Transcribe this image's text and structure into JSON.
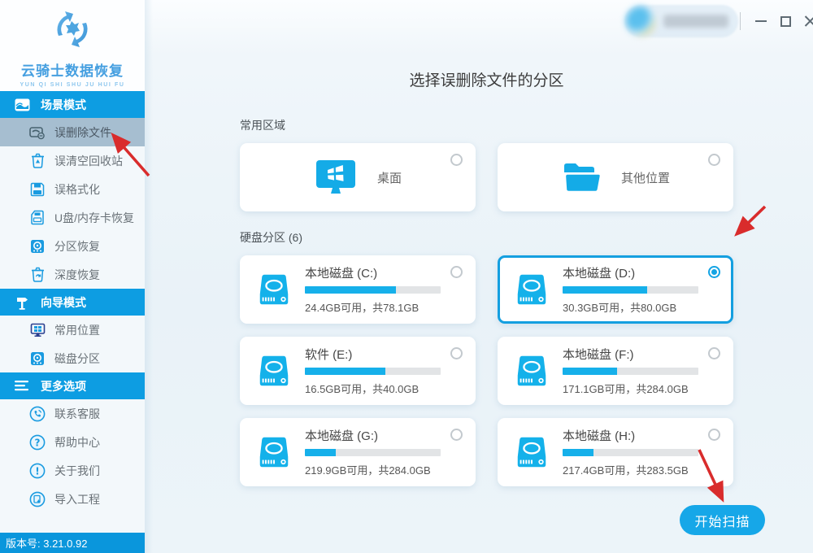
{
  "brand": {
    "name": "云骑士数据恢复",
    "tagline": "YUN QI SHI SHU JU HUI FU",
    "version": "版本号: 3.21.0.92"
  },
  "sidebar": {
    "sections": [
      {
        "label": "场景模式",
        "icon": "scene-mode-icon",
        "items": [
          {
            "label": "误删除文件",
            "icon": "folder-delete-icon",
            "selected": true
          },
          {
            "label": "误清空回收站",
            "icon": "recycle-bin-icon",
            "selected": false
          },
          {
            "label": "误格式化",
            "icon": "floppy-icon",
            "selected": false
          },
          {
            "label": "U盘/内存卡恢复",
            "icon": "memory-card-icon",
            "selected": false
          },
          {
            "label": "分区恢复",
            "icon": "partition-disk-icon",
            "selected": false
          },
          {
            "label": "深度恢复",
            "icon": "deep-recovery-icon",
            "selected": false
          }
        ]
      },
      {
        "label": "向导模式",
        "icon": "signpost-icon",
        "items": [
          {
            "label": "常用位置",
            "icon": "monitor-icon",
            "selected": false
          },
          {
            "label": "磁盘分区",
            "icon": "disk-icon",
            "selected": false
          }
        ]
      },
      {
        "label": "更多选项",
        "icon": "hamburger-icon",
        "items": [
          {
            "label": "联系客服",
            "icon": "phone-circle-icon",
            "selected": false
          },
          {
            "label": "帮助中心",
            "icon": "question-circle-icon",
            "selected": false
          },
          {
            "label": "关于我们",
            "icon": "exclaim-circle-icon",
            "selected": false
          },
          {
            "label": "导入工程",
            "icon": "import-circle-icon",
            "selected": false
          }
        ]
      }
    ]
  },
  "main": {
    "title": "选择误删除文件的分区",
    "common_section": {
      "label": "常用区域",
      "items": [
        {
          "label": "桌面",
          "icon": "desktop-windows-icon",
          "selected": false
        },
        {
          "label": "其他位置",
          "icon": "open-folder-icon",
          "selected": false
        }
      ]
    },
    "disk_section_label": "硬盘分区 (6)",
    "disks": [
      {
        "name": "本地磁盘 (C:)",
        "usage": "24.4GB可用，共78.1GB",
        "used_percent": 67,
        "selected": false
      },
      {
        "name": "本地磁盘 (D:)",
        "usage": "30.3GB可用，共80.0GB",
        "used_percent": 62,
        "selected": true
      },
      {
        "name": "软件 (E:)",
        "usage": "16.5GB可用，共40.0GB",
        "used_percent": 59,
        "selected": false
      },
      {
        "name": "本地磁盘 (F:)",
        "usage": "171.1GB可用，共284.0GB",
        "used_percent": 40,
        "selected": false
      },
      {
        "name": "本地磁盘 (G:)",
        "usage": "219.9GB可用，共284.0GB",
        "used_percent": 23,
        "selected": false
      },
      {
        "name": "本地磁盘 (H:)",
        "usage": "217.4GB可用，共283.5GB",
        "used_percent": 23,
        "selected": false
      }
    ],
    "scan_button": "开始扫描"
  },
  "colors": {
    "accent": "#16a7e8",
    "sidebar_header": "#0d9de2",
    "selected_item_bg": "#a6bed0",
    "version_bar": "#0a96dc",
    "bar_track": "#e2e4e6",
    "bar_fill": "#16b0ea",
    "annotation_arrow": "#d92c2c"
  },
  "icons": {
    "window": [
      "minimize-icon",
      "maximize-icon",
      "close-icon"
    ],
    "annotations": [
      "arrow-to-menu-item",
      "arrow-to-disk-d-radio",
      "arrow-to-scan-button"
    ]
  }
}
